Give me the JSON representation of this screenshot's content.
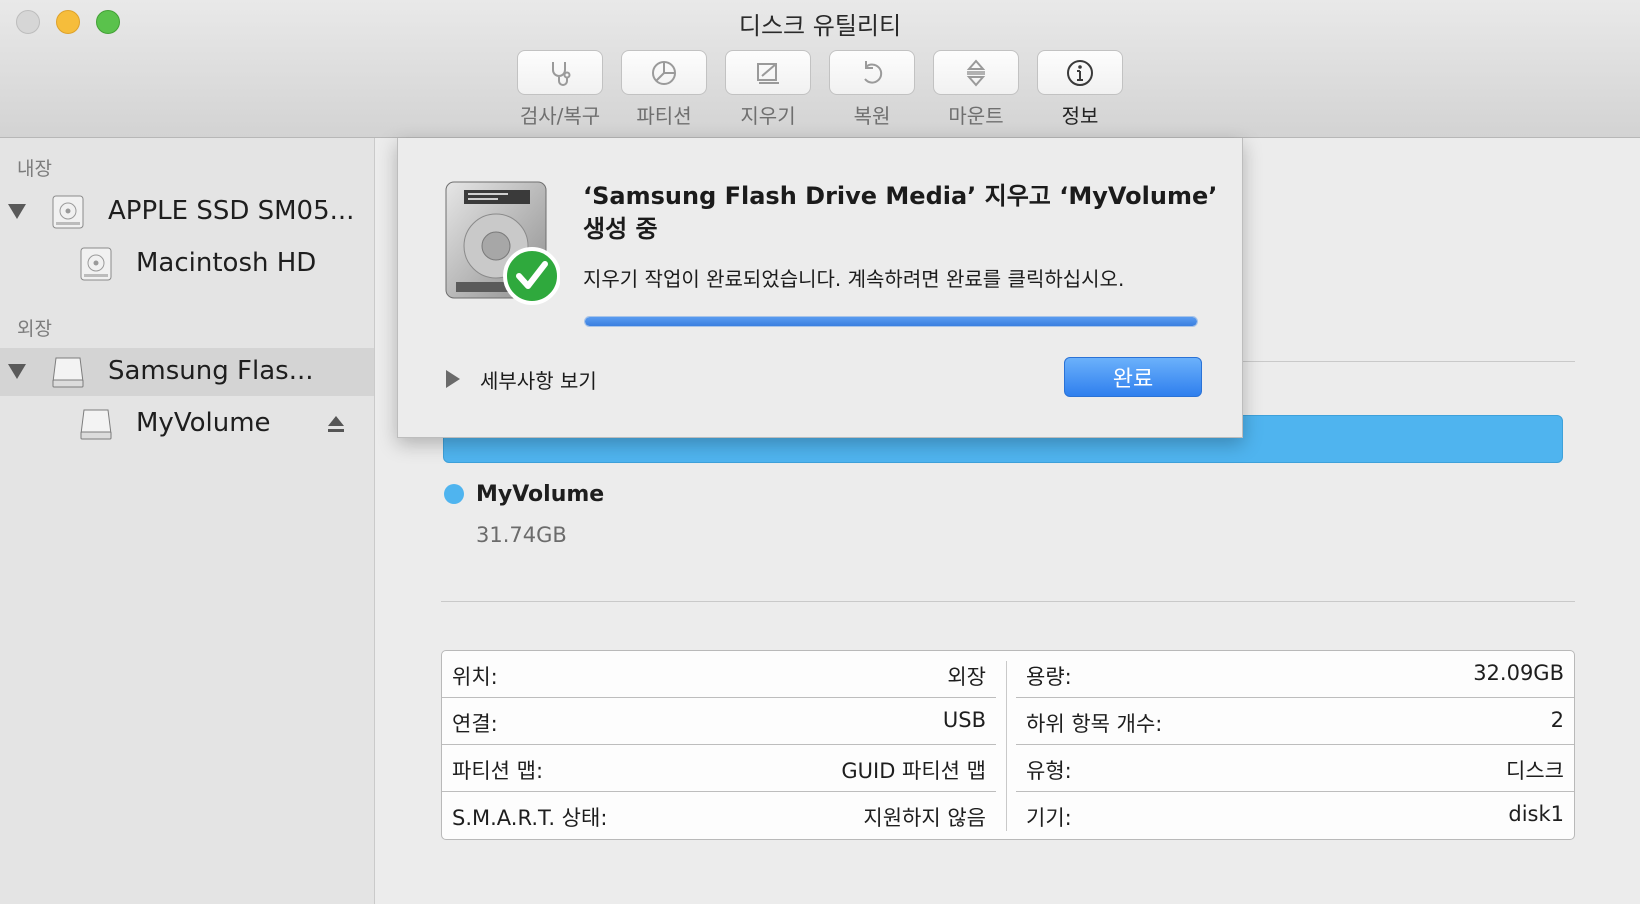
{
  "window": {
    "title": "디스크 유틸리티"
  },
  "toolbar": {
    "items": [
      {
        "label": "검사/복구",
        "icon": "stethoscope-icon"
      },
      {
        "label": "파티션",
        "icon": "pie-chart-icon"
      },
      {
        "label": "지우기",
        "icon": "eraser-icon"
      },
      {
        "label": "복원",
        "icon": "restore-icon"
      },
      {
        "label": "마운트",
        "icon": "mount-icon"
      },
      {
        "label": "정보",
        "icon": "info-icon"
      }
    ]
  },
  "sidebar": {
    "internal_label": "내장",
    "external_label": "외장",
    "items": [
      {
        "label": "APPLE SSD SM05..."
      },
      {
        "label": "Macintosh HD"
      },
      {
        "label": "Samsung Flas..."
      },
      {
        "label": "MyVolume"
      }
    ]
  },
  "sheet": {
    "title": "‘Samsung Flash Drive Media’ 지우고 ‘MyVolume’ 생성 중",
    "message": "지우기 작업이 완료되었습니다. 계속하려면 완료를 클릭하십시오.",
    "progress": 1.0,
    "details_label": "세부사항 보기",
    "done_label": "완료"
  },
  "volume": {
    "name": "MyVolume",
    "size": "31.74GB",
    "color": "#4fb4ef"
  },
  "info": {
    "left": [
      {
        "key": "위치:",
        "value": "외장"
      },
      {
        "key": "연결:",
        "value": "USB"
      },
      {
        "key": "파티션 맵:",
        "value": "GUID 파티션 맵"
      },
      {
        "key": "S.M.A.R.T. 상태:",
        "value": "지원하지 않음"
      }
    ],
    "right": [
      {
        "key": "용량:",
        "value": "32.09GB"
      },
      {
        "key": "하위 항목 개수:",
        "value": "2"
      },
      {
        "key": "유형:",
        "value": "디스크"
      },
      {
        "key": "기기:",
        "value": "disk1"
      }
    ]
  }
}
